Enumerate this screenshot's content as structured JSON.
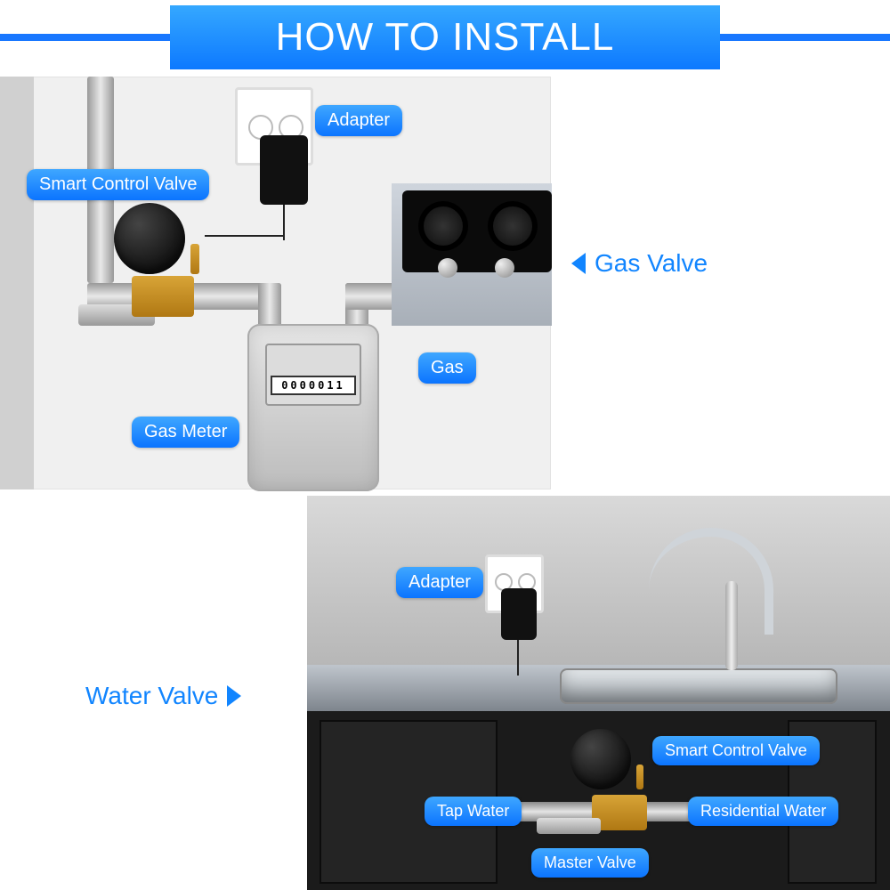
{
  "title": "HOW TO INSTALL",
  "sections": {
    "gas": {
      "label": "Gas Valve"
    },
    "water": {
      "label": "Water Valve"
    }
  },
  "gas_labels": {
    "smart_valve": "Smart Control Valve",
    "adapter": "Adapter",
    "gas": "Gas",
    "gas_meter": "Gas Meter"
  },
  "gas_meter": {
    "digits": "0000011"
  },
  "water_labels": {
    "adapter": "Adapter",
    "smart_valve": "Smart Control Valve",
    "tap_water": "Tap Water",
    "residential_water": "Residential Water",
    "master_valve": "Master Valve"
  }
}
